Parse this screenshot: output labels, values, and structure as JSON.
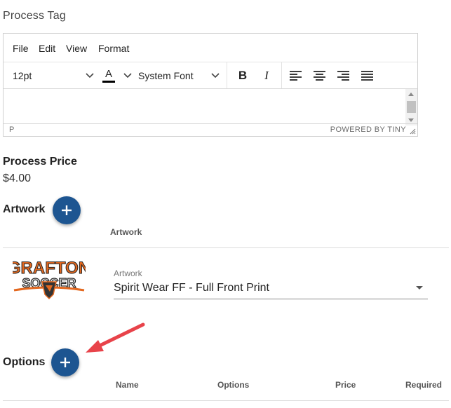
{
  "process_tag": {
    "label": "Process Tag",
    "editor": {
      "menu": [
        "File",
        "Edit",
        "View",
        "Format"
      ],
      "font_size": "12pt",
      "text_color_glyph": "A",
      "text_color": "#000000",
      "font_family": "System Font",
      "bold_glyph": "B",
      "italic_glyph": "I",
      "status_path": "P",
      "powered_by": "POWERED BY TINY",
      "icons": [
        "chevron-down-icon",
        "text-color-icon",
        "bold-icon",
        "italic-icon",
        "align-left-icon",
        "align-center-icon",
        "align-right-icon",
        "align-justify-icon",
        "resize-handle-icon"
      ]
    }
  },
  "process_price": {
    "label": "Process Price",
    "value": "$4.00"
  },
  "artwork": {
    "heading": "Artwork",
    "column_header": "Artwork",
    "item": {
      "field_label": "Artwork",
      "field_value": "Spirit Wear FF - Full Front Print",
      "logo_text_top": "GRAFTON",
      "logo_text_bottom": "SOCCER"
    }
  },
  "options": {
    "heading": "Options",
    "columns": [
      "Name",
      "Options",
      "Price",
      "Required"
    ]
  },
  "colors": {
    "accent": "#1d5591",
    "annotation_arrow": "#e8434a",
    "logo_orange": "#e3681f"
  }
}
